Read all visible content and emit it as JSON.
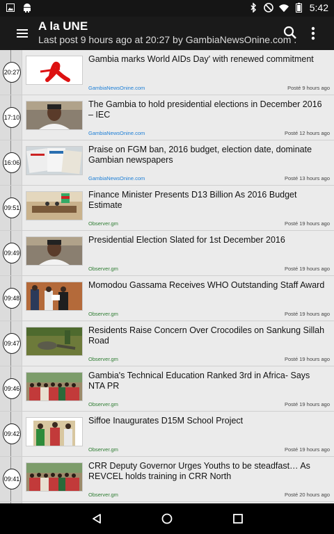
{
  "status_bar": {
    "time": "5:42",
    "icons": [
      "image-icon",
      "android-icon",
      "bluetooth-icon",
      "do-not-disturb-icon",
      "wifi-icon",
      "battery-icon"
    ]
  },
  "app_bar": {
    "title": "A la UNE",
    "subtitle": "Last post 9 hours ago at 20:27 by GambiaNewsOnine.com .",
    "icons": [
      "menu-icon",
      "search-icon",
      "more-icon"
    ]
  },
  "colors": {
    "source_link": "#1c7ed6",
    "source_observer": "#2e7d32"
  },
  "articles": [
    {
      "time": "20:27",
      "headline": "Gambia marks World AIDs Day' with renewed commitment",
      "source": "GambiaNewsOnine.com",
      "source_color": "#1c7ed6",
      "posted": "Posté 9 hours ago",
      "thumb": "red-ribbon-image"
    },
    {
      "time": "17:10",
      "headline": "The Gambia to hold presidential elections in December 2016 – IEC",
      "source": "GambiaNewsOnine.com",
      "source_color": "#1c7ed6",
      "posted": "Posté 12 hours ago",
      "thumb": "official-portrait-image"
    },
    {
      "time": "16:06",
      "headline": "Praise on FGM ban, 2016 budget, election date, dominate Gambian newspapers",
      "source": "GambiaNewsOnine.com",
      "source_color": "#1c7ed6",
      "posted": "Posté 13 hours ago",
      "thumb": "newspapers-image"
    },
    {
      "time": "09:51",
      "headline": "Finance Minister Presents D13 Billion As 2016 Budget Estimate",
      "source": "Observer.gm",
      "source_color": "#2e7d32",
      "posted": "Posté 19 hours ago",
      "thumb": "parliament-image"
    },
    {
      "time": "09:49",
      "headline": "Presidential Election Slated for 1st December 2016",
      "source": "Observer.gm",
      "source_color": "#2e7d32",
      "posted": "Posté 19 hours ago",
      "thumb": "official-portrait-image"
    },
    {
      "time": "09:48",
      "headline": "Momodou Gassama Receives WHO Outstanding Staff Award",
      "source": "Observer.gm",
      "source_color": "#2e7d32",
      "posted": "Posté 19 hours ago",
      "thumb": "award-ceremony-image"
    },
    {
      "time": "09:47",
      "headline": "Residents Raise Concern Over Crocodiles on Sankung Sillah Road",
      "source": "Observer.gm",
      "source_color": "#2e7d32",
      "posted": "Posté 19 hours ago",
      "thumb": "crocodile-image"
    },
    {
      "time": "09:46",
      "headline": "Gambia's Technical Education Ranked 3rd in Africa- Says NTA PR",
      "source": "Observer.gm",
      "source_color": "#2e7d32",
      "posted": "Posté 19 hours ago",
      "thumb": "group-photo-image"
    },
    {
      "time": "09:42",
      "headline": "Siffoe Inaugurates D15M School Project",
      "source": "Observer.gm",
      "source_color": "#2e7d32",
      "posted": "Posté 19 hours ago",
      "thumb": "school-event-image"
    },
    {
      "time": "09:41",
      "headline": "CRR Deputy Governor Urges Youths to be steadfast…   As REVCEL holds training in CRR North",
      "source": "Observer.gm",
      "source_color": "#2e7d32",
      "posted": "Posté 20 hours ago",
      "thumb": "group-photo-image"
    }
  ],
  "nav_bar": {
    "icons": [
      "back-icon",
      "home-icon",
      "recents-icon"
    ]
  }
}
